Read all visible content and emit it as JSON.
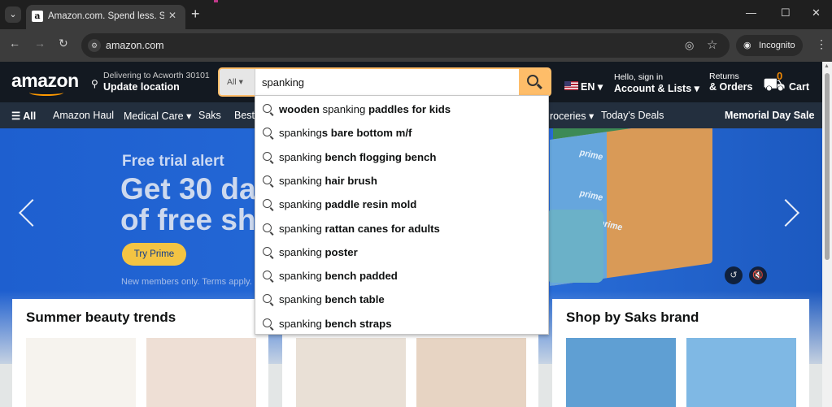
{
  "browser": {
    "tab_title": "Amazon.com. Spend less. Smile more.",
    "tab_favicon": "a",
    "url": "amazon.com",
    "incognito_label": "Incognito"
  },
  "header": {
    "logo": "amazon",
    "deliver_line1": "Delivering to Acworth 30101",
    "deliver_line2": "Update location",
    "search_category": "All",
    "search_query": "spanking",
    "lang": "EN",
    "signin_line1": "Hello, sign in",
    "signin_line2": "Account & Lists",
    "returns_line1": "Returns",
    "returns_line2": "& Orders",
    "cart_count": "0",
    "cart_label": "Cart"
  },
  "subnav": {
    "all": "All",
    "items": [
      "Amazon Haul",
      "Medical Care",
      "Saks",
      "Best",
      "roceries",
      "Today's Deals"
    ],
    "promo": "Memorial Day Sale"
  },
  "hero": {
    "eyebrow": "Free trial alert",
    "line1": "Get 30 da",
    "line2": "of free sh",
    "cta": "Try Prime",
    "terms": "New members only. Terms apply.",
    "box_text": "prime"
  },
  "cards": [
    {
      "title": "Summer beauty trends"
    },
    {
      "title": ""
    },
    {
      "title": "Shop by Saks brand"
    }
  ],
  "suggestions": [
    {
      "pre": "wooden",
      "mid": " spanking ",
      "post": "paddles for kids",
      "style": "bold-ends"
    },
    {
      "pre": "spanking",
      "post": "s bare bottom m/f",
      "style": "normal-bold"
    },
    {
      "pre": "spanking ",
      "post": "bench flogging bench",
      "style": "normal-bold"
    },
    {
      "pre": "spanking ",
      "post": "hair brush",
      "style": "normal-bold"
    },
    {
      "pre": "spanking ",
      "post": "paddle resin mold",
      "style": "normal-bold"
    },
    {
      "pre": "spanking ",
      "post": "rattan canes for adults",
      "style": "normal-bold"
    },
    {
      "pre": "spanking ",
      "post": "poster",
      "style": "normal-bold"
    },
    {
      "pre": "spanking ",
      "post": "bench padded",
      "style": "normal-bold"
    },
    {
      "pre": "spanking ",
      "post": "bench table",
      "style": "normal-bold"
    },
    {
      "pre": "spanking ",
      "post": "bench straps",
      "style": "normal-bold"
    }
  ],
  "colors": {
    "amazon_dark": "#131921",
    "amazon_subnav": "#232f3e",
    "search_button": "#febd69",
    "prime_blue": "#1b5fc6",
    "cta_yellow": "#f3c443"
  }
}
